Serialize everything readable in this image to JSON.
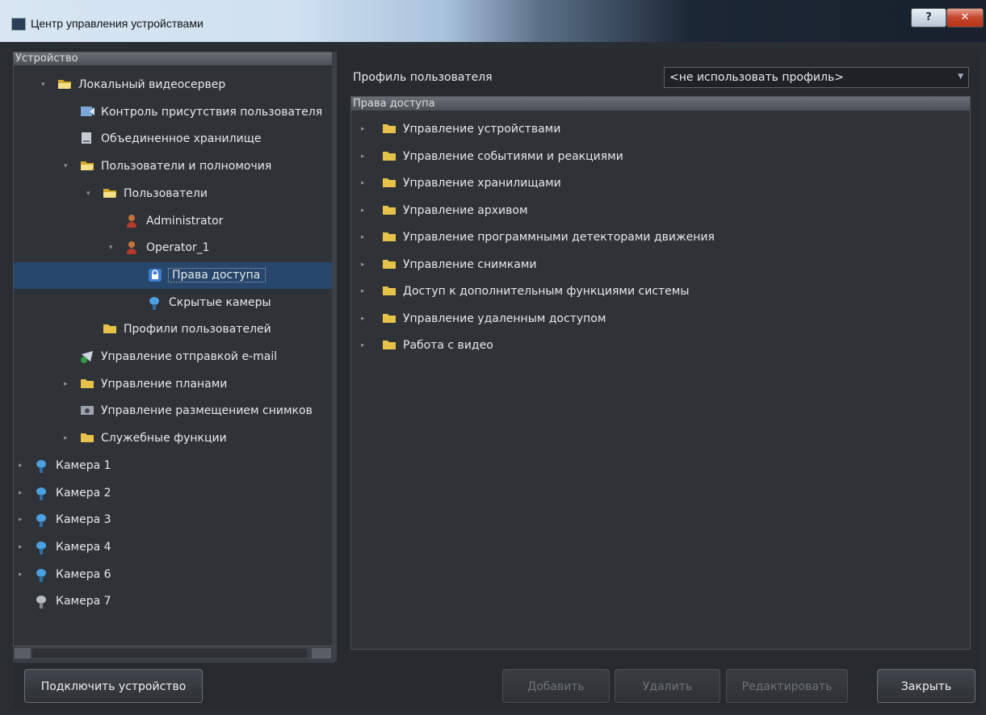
{
  "window": {
    "title": "Центр управления устройствами",
    "help_label": "?",
    "close_label": "✕"
  },
  "tree": {
    "header": "Устройство",
    "items": [
      {
        "label": "Локальный видеосервер",
        "icon": "open-folder-icon",
        "expander": "expanded"
      },
      {
        "label": "Контроль присутствия пользователя",
        "icon": "user-presence-icon",
        "expander": "none"
      },
      {
        "label": "Объединенное хранилище",
        "icon": "storage-icon",
        "expander": "none"
      },
      {
        "label": "Пользователи и полномочия",
        "icon": "open-folder-icon",
        "expander": "expanded"
      },
      {
        "label": "Пользователи",
        "icon": "open-folder-icon",
        "expander": "expanded"
      },
      {
        "label": "Administrator",
        "icon": "user-icon",
        "expander": "none"
      },
      {
        "label": "Operator_1",
        "icon": "user-icon",
        "expander": "expanded"
      },
      {
        "label": "Права доступа",
        "icon": "lock-icon",
        "expander": "none",
        "selected": true
      },
      {
        "label": "Скрытые камеры",
        "icon": "camera-icon",
        "expander": "none"
      },
      {
        "label": "Профили пользователей",
        "icon": "folder-icon",
        "expander": "none"
      },
      {
        "label": "Управление отправкой e-mail",
        "icon": "email-icon",
        "expander": "none"
      },
      {
        "label": "Управление планами",
        "icon": "folder-icon",
        "expander": "collapsed"
      },
      {
        "label": "Управление размещением снимков",
        "icon": "snapshot-icon",
        "expander": "none"
      },
      {
        "label": "Служебные функции",
        "icon": "folder-icon",
        "expander": "collapsed"
      },
      {
        "label": "Камера 1",
        "icon": "camera-icon",
        "expander": "collapsed"
      },
      {
        "label": "Камера 2",
        "icon": "camera-icon",
        "expander": "collapsed"
      },
      {
        "label": "Камера 3",
        "icon": "camera-icon",
        "expander": "collapsed"
      },
      {
        "label": "Камера 4",
        "icon": "camera-icon",
        "expander": "collapsed"
      },
      {
        "label": "Камера 6",
        "icon": "camera-icon",
        "expander": "collapsed"
      },
      {
        "label": "Камера 7",
        "icon": "camera-disabled-icon",
        "expander": "none"
      }
    ]
  },
  "profile": {
    "label": "Профиль пользователя",
    "value": "<не использовать профиль>"
  },
  "rights": {
    "header": "Права доступа",
    "items": [
      "Управление устройствами",
      "Управление событиями и реакциями",
      "Управление хранилищами",
      "Управление архивом",
      "Управление программными детекторами движения",
      "Управление снимками",
      "Доступ к дополнительным функциями системы",
      "Управление удаленным доступом",
      "Работа с видео"
    ]
  },
  "buttons": {
    "connect": "Подключить устройство",
    "add": "Добавить",
    "delete": "Удалить",
    "edit": "Редактировать",
    "close": "Закрыть"
  },
  "colors": {
    "selection": "#26466b",
    "folder": "#e3bb3a",
    "background": "#2f3338"
  }
}
